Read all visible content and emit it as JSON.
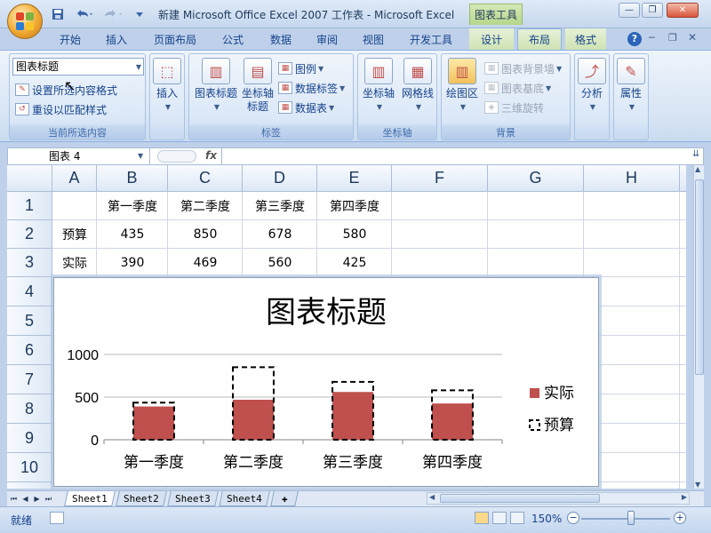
{
  "window": {
    "title": "新建 Microsoft Office Excel 2007 工作表 - Microsoft Excel",
    "context_group": "图表工具",
    "controls": {
      "minimize": "—",
      "restore": "❐",
      "close": "✕"
    }
  },
  "quick_access": {
    "save_icon": "save-icon",
    "undo_icon": "undo-icon",
    "redo_icon": "redo-icon"
  },
  "ribbon_tabs": [
    {
      "label": "开始"
    },
    {
      "label": "插入"
    },
    {
      "label": "页面布局"
    },
    {
      "label": "公式"
    },
    {
      "label": "数据"
    },
    {
      "label": "审阅"
    },
    {
      "label": "视图"
    },
    {
      "label": "开发工具"
    },
    {
      "label": "设计"
    },
    {
      "label": "布局"
    },
    {
      "label": "格式"
    }
  ],
  "active_tab": "布局",
  "ribbon": {
    "current_selection": {
      "dropdown_value": "图表标题",
      "format_selection": "设置所选内容格式",
      "reset_style": "重设以匹配样式",
      "label": "当前所选内容"
    },
    "insert": {
      "label": "插入"
    },
    "labels_group": {
      "chart_title": "图表标题",
      "axis_title_line1": "坐标轴",
      "axis_title_line2": "标题",
      "legend": "图例",
      "data_labels": "数据标签",
      "data_table": "数据表",
      "label": "标签"
    },
    "axes_group": {
      "axes": "坐标轴",
      "gridlines": "网格线",
      "label": "坐标轴"
    },
    "background_group": {
      "plot_area": "绘图区",
      "chart_wall": "图表背景墙",
      "chart_floor": "图表基底",
      "rotation_3d": "三维旋转",
      "label": "背景"
    },
    "analysis": {
      "label": "分析"
    },
    "properties": {
      "label": "属性"
    }
  },
  "formula_bar": {
    "name_box": "图表 4",
    "fx": "fx",
    "value": ""
  },
  "sheet": {
    "columns": [
      "A",
      "B",
      "C",
      "D",
      "E",
      "F",
      "G",
      "H"
    ],
    "rows": [
      "1",
      "2",
      "3",
      "4",
      "5",
      "6",
      "7",
      "8",
      "9",
      "10"
    ],
    "cells": {
      "B1": "第一季度",
      "C1": "第二季度",
      "D1": "第三季度",
      "E1": "第四季度",
      "A2": "预算",
      "B2": "435",
      "C2": "850",
      "D2": "678",
      "E2": "580",
      "A3": "实际",
      "B3": "390",
      "C3": "469",
      "D3": "560",
      "E3": "425"
    }
  },
  "chart_data": {
    "type": "bar",
    "title": "图表标题",
    "categories": [
      "第一季度",
      "第二季度",
      "第三季度",
      "第四季度"
    ],
    "series": [
      {
        "name": "实际",
        "values": [
          390,
          469,
          560,
          425
        ],
        "color": "#c0504d",
        "style": "solid"
      },
      {
        "name": "预算",
        "values": [
          435,
          850,
          678,
          580
        ],
        "color": "#000000",
        "style": "dashed-outline"
      }
    ],
    "ylim": [
      0,
      1000
    ],
    "yticks": [
      "0",
      "500",
      "1000"
    ],
    "xlabel": "",
    "ylabel": "",
    "grid": true,
    "legend": "right"
  },
  "sheet_tabs": [
    {
      "label": "Sheet1"
    },
    {
      "label": "Sheet2"
    },
    {
      "label": "Sheet3"
    },
    {
      "label": "Sheet4"
    }
  ],
  "active_sheet": "Sheet1",
  "status_bar": {
    "ready": "就绪",
    "zoom": "150%",
    "zoom_out": "−",
    "zoom_in": "+"
  }
}
